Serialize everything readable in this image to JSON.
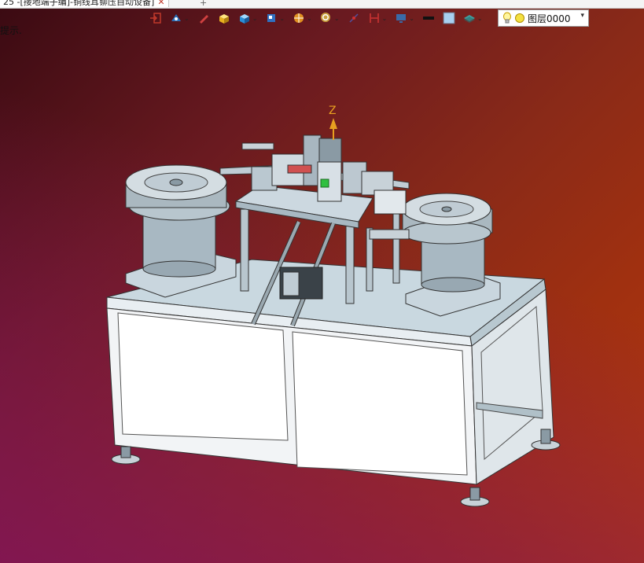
{
  "tab": {
    "title": "25 -[接地端子编]-铜线耳铆压自动设备]",
    "close": "✕",
    "add": "+"
  },
  "hint": "提示.",
  "toolbar": {
    "tools": [
      {
        "name": "exit-icon",
        "caret": false,
        "color": "#c0392b"
      },
      {
        "name": "eye-view-icon",
        "caret": true,
        "color": "#2a6fb8"
      },
      {
        "name": "pen-icon",
        "caret": false,
        "color": "#d04040"
      },
      {
        "name": "box-yellow-icon",
        "caret": false,
        "color": "#e8b020"
      },
      {
        "name": "box-blue-icon",
        "caret": true,
        "color": "#2a8fd8"
      },
      {
        "name": "cube-view-icon",
        "caret": true,
        "color": "#3070c0"
      },
      {
        "name": "shading-icon",
        "caret": true,
        "color": "#e09020"
      },
      {
        "name": "zoom-icon",
        "caret": true,
        "color": "#c8a040"
      },
      {
        "name": "origin-icon",
        "caret": false,
        "color": "#5050a0"
      },
      {
        "name": "section-icon",
        "caret": true,
        "color": "#c03030"
      },
      {
        "name": "display-icon",
        "caret": true,
        "color": "#3a6aa8"
      },
      {
        "name": "line-black-icon",
        "caret": false,
        "color": "#111111"
      },
      {
        "name": "fill-lightblue-icon",
        "caret": false,
        "color": "#a8d0f0"
      },
      {
        "name": "layers-icon",
        "caret": true,
        "color": "#40a0a0"
      }
    ]
  },
  "layer": {
    "name": "图层0000",
    "dropdown": "▾"
  },
  "viewport": {
    "axis": "Z",
    "bg_top": "#3a0a12",
    "bg_right": "#b43a0c",
    "bg_bottom": "#82145a"
  }
}
